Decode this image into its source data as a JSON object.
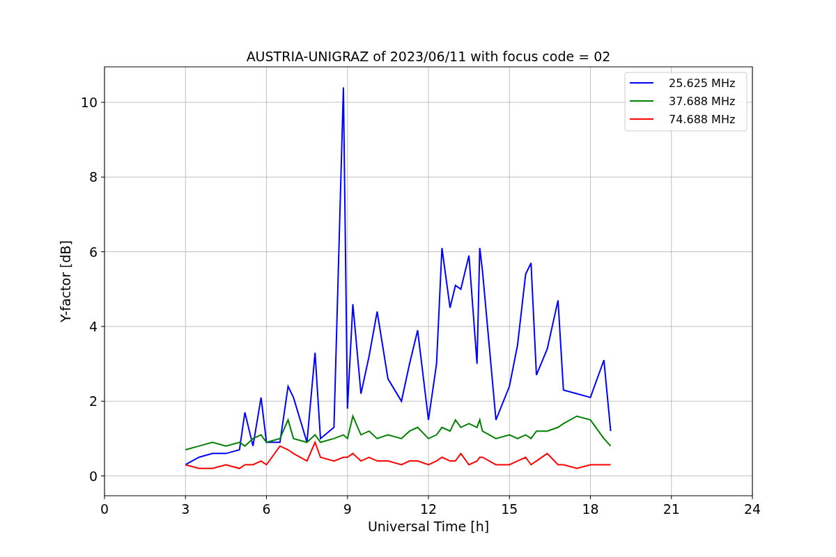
{
  "chart_data": {
    "type": "line",
    "title": "AUSTRIA-UNIGRAZ of 2023/06/11 with focus code = 02",
    "xlabel": "Universal Time [h]",
    "ylabel": "Y-factor [dB]",
    "x": [
      3,
      3.5,
      4,
      4.5,
      5,
      5.2,
      5.5,
      5.8,
      6,
      6.5,
      6.8,
      7,
      7.5,
      7.8,
      8,
      8.5,
      8.85,
      9,
      9.2,
      9.5,
      9.8,
      10.1,
      10.5,
      11,
      11.3,
      11.6,
      12,
      12.3,
      12.5,
      12.8,
      13,
      13.2,
      13.5,
      13.8,
      13.9,
      14,
      14.5,
      15,
      15.3,
      15.6,
      15.8,
      16,
      16.4,
      16.8,
      17,
      17.5,
      18,
      18.5,
      18.75
    ],
    "series": [
      {
        "name": "25.625 MHz",
        "color": "#0000ff",
        "values": [
          0.3,
          0.5,
          0.6,
          0.6,
          0.7,
          1.7,
          0.8,
          2.1,
          0.9,
          0.9,
          2.4,
          2.1,
          0.9,
          3.3,
          1.0,
          1.3,
          10.4,
          1.8,
          4.6,
          2.2,
          3.2,
          4.4,
          2.6,
          2.0,
          3.0,
          3.9,
          1.5,
          3.0,
          6.1,
          4.5,
          5.1,
          5.0,
          5.9,
          3.0,
          6.1,
          5.5,
          1.5,
          2.4,
          3.5,
          5.4,
          5.7,
          2.7,
          3.4,
          4.7,
          2.3,
          2.2,
          2.1,
          3.1,
          1.2
        ]
      },
      {
        "name": "37.688 MHz",
        "color": "#008000",
        "values": [
          0.7,
          0.8,
          0.9,
          0.8,
          0.9,
          0.8,
          1.0,
          1.1,
          0.9,
          1.0,
          1.5,
          1.0,
          0.9,
          1.1,
          0.9,
          1.0,
          1.1,
          1.0,
          1.6,
          1.1,
          1.2,
          1.0,
          1.1,
          1.0,
          1.2,
          1.3,
          1.0,
          1.1,
          1.3,
          1.2,
          1.5,
          1.3,
          1.4,
          1.3,
          1.5,
          1.2,
          1.0,
          1.1,
          1.0,
          1.1,
          1.0,
          1.2,
          1.2,
          1.3,
          1.4,
          1.6,
          1.5,
          1.0,
          0.8
        ]
      },
      {
        "name": "74.688 MHz",
        "color": "#ff0000",
        "values": [
          0.3,
          0.2,
          0.2,
          0.3,
          0.2,
          0.3,
          0.3,
          0.4,
          0.3,
          0.8,
          0.7,
          0.6,
          0.4,
          0.9,
          0.5,
          0.4,
          0.5,
          0.5,
          0.6,
          0.4,
          0.5,
          0.4,
          0.4,
          0.3,
          0.4,
          0.4,
          0.3,
          0.4,
          0.5,
          0.4,
          0.4,
          0.6,
          0.3,
          0.4,
          0.5,
          0.5,
          0.3,
          0.3,
          0.4,
          0.5,
          0.3,
          0.4,
          0.6,
          0.3,
          0.3,
          0.2,
          0.3,
          0.3,
          0.3
        ]
      }
    ],
    "xlim": [
      0,
      24
    ],
    "ylim": [
      -0.53,
      10.95
    ],
    "xticks": [
      0,
      3,
      6,
      9,
      12,
      15,
      18,
      21,
      24
    ],
    "yticks": [
      0,
      2,
      4,
      6,
      8,
      10
    ],
    "grid": true,
    "legend": "upper right"
  }
}
